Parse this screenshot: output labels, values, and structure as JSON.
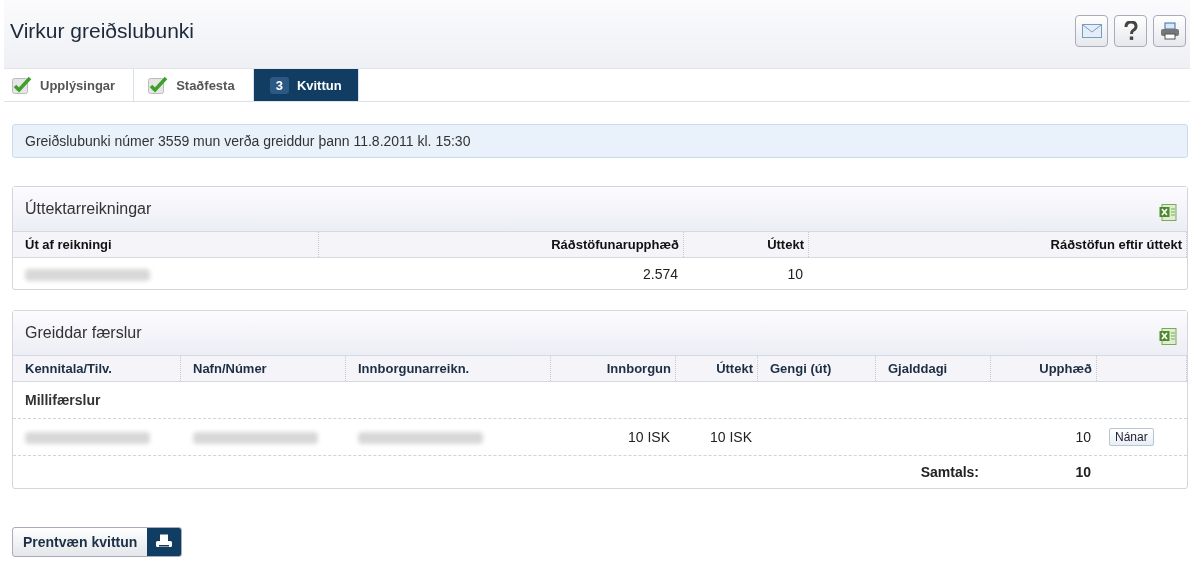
{
  "header": {
    "title": "Virkur greiðslubunki"
  },
  "tabs": [
    {
      "label": "Upplýsingar",
      "selected": false,
      "completed": true
    },
    {
      "label": "Staðfesta",
      "selected": false,
      "completed": true
    },
    {
      "label": "Kvittun",
      "selected": true,
      "completed": false,
      "number": "3"
    }
  ],
  "notice": "Greiðslubunki númer 3559 mun verða greiddur þann 11.8.2011 kl. 15:30",
  "withdrawals": {
    "title": "Úttektarreikningar",
    "columns": [
      "Út af reikningi",
      "Ráðstöfunarupphæð",
      "Úttekt",
      "Ráðstöfun eftir úttekt"
    ],
    "rows": [
      {
        "cells": [
          {
            "kind": "blurred"
          },
          {
            "kind": "text",
            "text": "2.574"
          },
          {
            "kind": "text",
            "text": "10"
          },
          {
            "kind": "empty"
          }
        ]
      }
    ]
  },
  "payments": {
    "title": "Greiddar færslur",
    "columns": [
      "Kennitala/Tilv.",
      "Nafn/Númer",
      "Innborgunarreikn.",
      "Innborgun",
      "Úttekt",
      "Gengi (út)",
      "Gjalddagi",
      "Upphæð"
    ],
    "group": "Millifærslur",
    "rows": [
      {
        "cells": [
          {
            "kind": "blurred"
          },
          {
            "kind": "blurred"
          },
          {
            "kind": "blurred"
          },
          {
            "kind": "text",
            "text": "10 ISK"
          },
          {
            "kind": "text",
            "text": "10 ISK"
          },
          {
            "kind": "empty"
          },
          {
            "kind": "empty"
          },
          {
            "kind": "text",
            "text": "10"
          }
        ],
        "action": "Nánar"
      }
    ],
    "total_label": "Samtals:",
    "total": "10"
  },
  "print_button": "Prentvæn kvittun"
}
